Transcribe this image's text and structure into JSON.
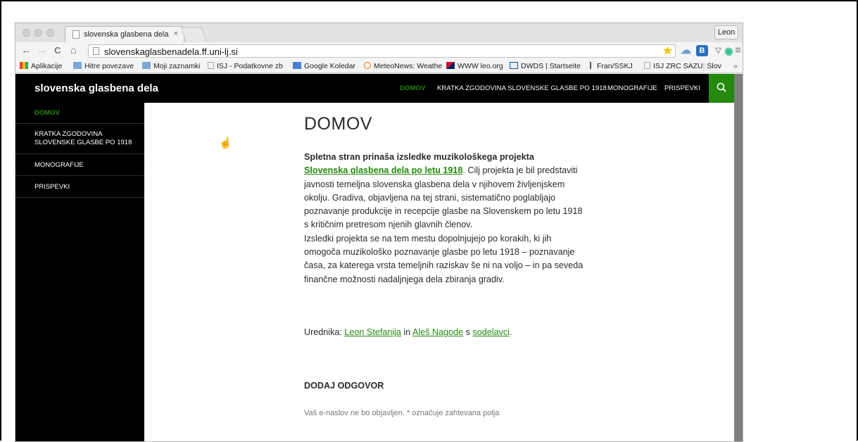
{
  "browser": {
    "tab_title": "slovenska glasbena dela",
    "tab_close": "×",
    "profile_name": "Leon",
    "url": "slovenskaglasbenadela.ff.uni-lj.si",
    "nav": {
      "back": "←",
      "forward": "→",
      "reload": "C",
      "home": "⌂"
    },
    "extensions": [
      {
        "icon": "star-icon",
        "label": "★",
        "color": "#f4c20d"
      },
      {
        "icon": "cloud-icon",
        "label": "☁",
        "color": "#6a9fcf"
      },
      {
        "icon": "b-extension-icon",
        "label": "B",
        "color": "#2d6fb7"
      },
      {
        "icon": "shield-icon",
        "label": "▽",
        "color": "#9a9a9a"
      },
      {
        "icon": "circle-extension-icon",
        "label": "◉",
        "color": "#2fbf8f"
      },
      {
        "icon": "menu-icon",
        "label": "≡",
        "color": "#777777"
      }
    ]
  },
  "bookmarks": [
    {
      "label": "Aplikacije",
      "icon": "apps-icon"
    },
    {
      "label": "Hitre povezave",
      "icon": "folder-icon"
    },
    {
      "label": "Moji zaznamki",
      "icon": "folder-icon"
    },
    {
      "label": "ISJ - Podatkovne zb",
      "icon": "page-icon"
    },
    {
      "label": "Google Koledar",
      "icon": "calendar-icon"
    },
    {
      "label": "MeteoNews: Weathe",
      "icon": "weather-icon"
    },
    {
      "label": "WWW leo.org",
      "icon": "flag-icon"
    },
    {
      "label": "DWDS | Startseite",
      "icon": "dwds-icon"
    },
    {
      "label": "Fran/SSKJ",
      "icon": "f-icon"
    },
    {
      "label": "ISJ ZRC SAZU: Slov",
      "icon": "page-icon"
    }
  ],
  "bookmarks_more": "»",
  "site": {
    "title": "slovenska glasbena dela",
    "menu": [
      "DOMOV",
      "KRATKA ZGODOVINA SLOVENSKE GLASBE PO 1918",
      "MONOGRAFIJE",
      "PRISPEVKI"
    ],
    "search_icon": "⚲",
    "sidebar": [
      {
        "line1": "DOMOV",
        "line2": ""
      },
      {
        "line1": "KRATKA ZGODOVINA",
        "line2": "SLOVENSKE GLASBE PO 1918"
      },
      {
        "line1": "MONOGRAFIJE",
        "line2": ""
      },
      {
        "line1": "PRISPEVKI",
        "line2": ""
      }
    ]
  },
  "article": {
    "title": "DOMOV",
    "intro_bold": "Spletna stran prinaša izsledke muzikološkega projekta",
    "project_link": "Slovenska glasbena dela po letu 1918",
    "para1_rest": ". Cilj projekta je bil predstaviti javnosti temeljna slovenska glasbena dela v njihovem življenjskem okolju. Gradiva, objavljena na tej strani, sistematično poglabljajo poznavanje produkcije in recepcije glasbe na Slovenskem po letu 1918 s kritičnim pretresom njenih glavnih členov.",
    "para2": "Izsledki projekta se na tem mestu dopolnjujejo po korakih, ki jih omogoča muzikološko poznavanje glasbe po letu 1918 – poznavanje časa, za katerega vrsta  temeljnih raziskav še ni na voljo – in pa seveda finančne možnosti nadaljnjega dela zbiranja gradiv.",
    "editors_prefix": "Urednika: ",
    "editor1": "Leon Stefanija",
    "editors_and": " in ",
    "editor2": "Aleš Nagode",
    "editors_with": " s ",
    "collaborators": "sodelavci",
    "editors_end": ".",
    "reply_heading": "DODAJ ODGOVOR",
    "reply_note": "Vaš e-naslov ne bo objavljen. * označuje zahtevana polja"
  }
}
